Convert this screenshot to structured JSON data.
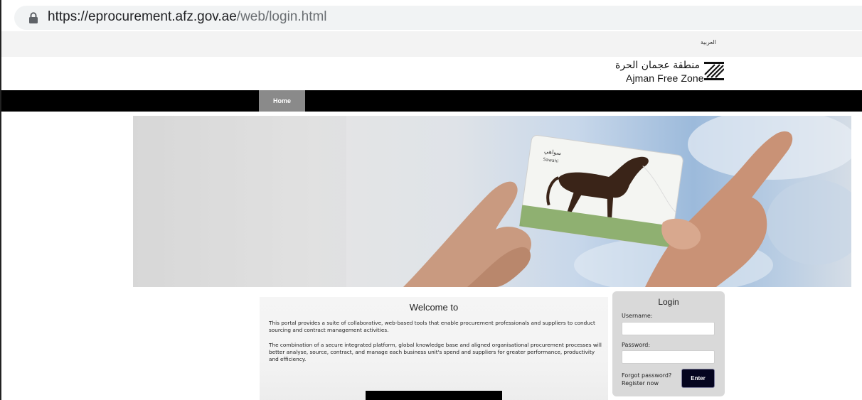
{
  "browser": {
    "url_host": "https://eprocurement.afz.gov.ae",
    "url_path": "/web/login.html",
    "lock_icon": "lock-icon"
  },
  "header": {
    "language_link": "العربية",
    "logo_arabic": "منطقة عجمان الحرة",
    "logo_english": "Ajman Free Zone"
  },
  "nav": {
    "items": [
      {
        "label": "Home",
        "active": true
      }
    ]
  },
  "banner": {
    "card_arabic": "سواهي",
    "card_english": "Sawahi"
  },
  "welcome": {
    "title": "Welcome to",
    "paragraph1": "This portal provides a suite of collaborative, web-based tools that enable procurement professionals and suppliers to conduct sourcing and contract management activities.",
    "paragraph2": "The combination of a secure integrated platform, global knowledge base and aligned organisational procurement processes will better analyse, source, contract, and manage each business unit's spend and suppliers for greater performance, productivity and efficiency."
  },
  "login": {
    "title": "Login",
    "username_label": "Username:",
    "username_value": "",
    "password_label": "Password:",
    "password_value": "",
    "forgot_link": "Forgot password?",
    "register_link": "Register now",
    "enter_button": "Enter"
  },
  "colors": {
    "nav_background": "#000000",
    "nav_active": "#8a8a8a",
    "login_panel": "#d9d9d9",
    "enter_button": "#05051f"
  }
}
